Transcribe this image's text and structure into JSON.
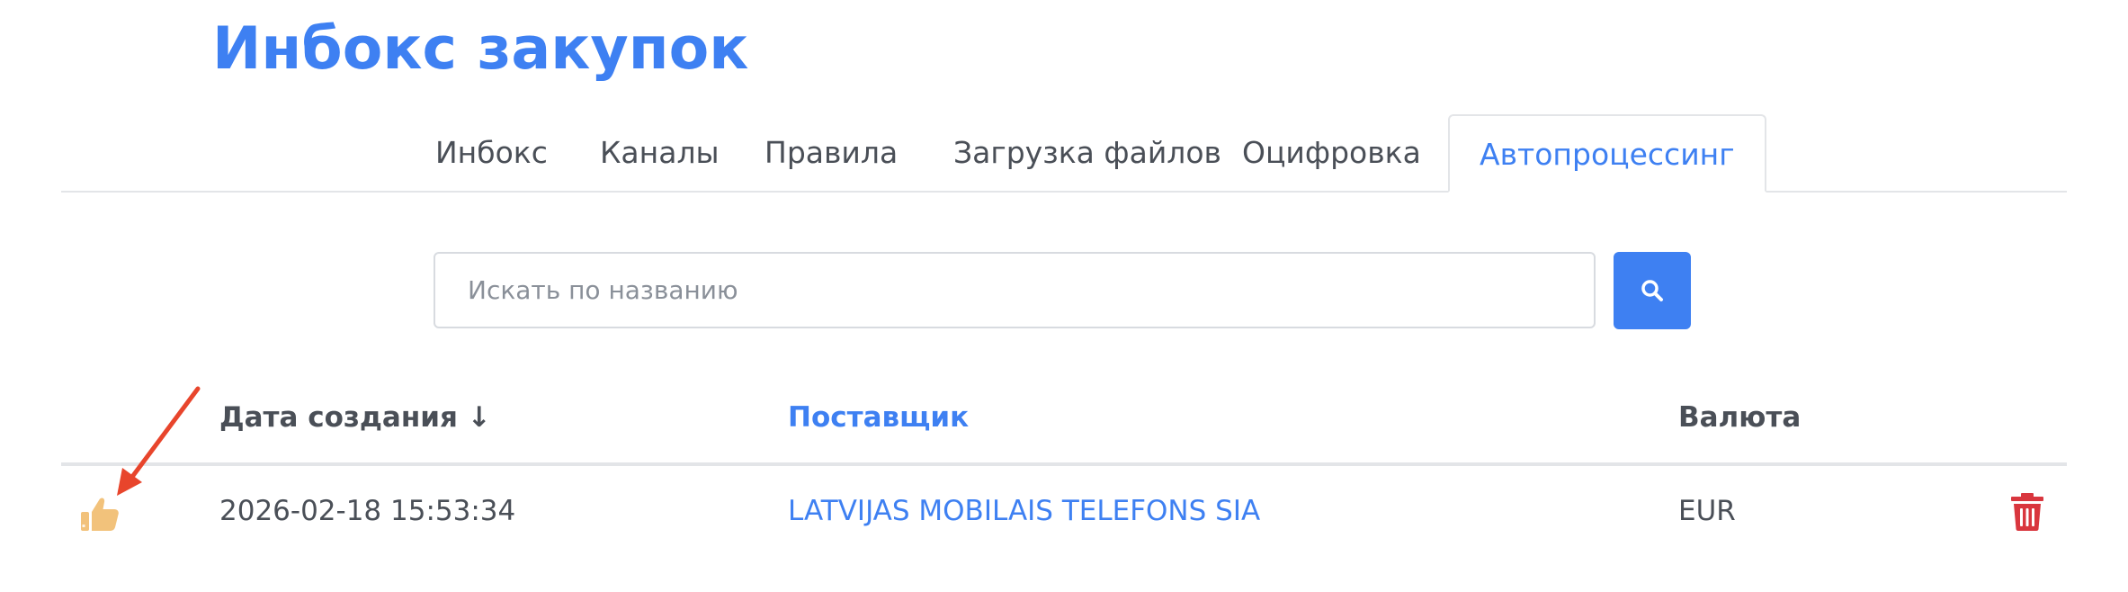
{
  "page_title": "Инбокс закупок",
  "tabs": [
    {
      "label": "Инбокс"
    },
    {
      "label": "Каналы"
    },
    {
      "label": "Правила"
    },
    {
      "label": "Загрузка файлов"
    },
    {
      "label": "Оцифровка"
    },
    {
      "label": "Автопроцессинг",
      "active": true
    }
  ],
  "search": {
    "placeholder": "Искать по названию",
    "value": ""
  },
  "table": {
    "columns": {
      "created": "Дата создания ↓",
      "supplier": "Поставщик",
      "currency": "Валюта"
    },
    "rows": [
      {
        "created": "2026-02-18 15:53:34",
        "supplier": "LATVIJAS MOBILAIS TELEFONS SIA",
        "currency": "EUR",
        "status_icon": "thumbs-up-icon"
      }
    ]
  },
  "colors": {
    "accent": "#3e80f2",
    "text": "#4a4f57",
    "delete": "#d9363e",
    "thumb": "#f2c27b",
    "annotation_arrow": "#e8452c"
  }
}
